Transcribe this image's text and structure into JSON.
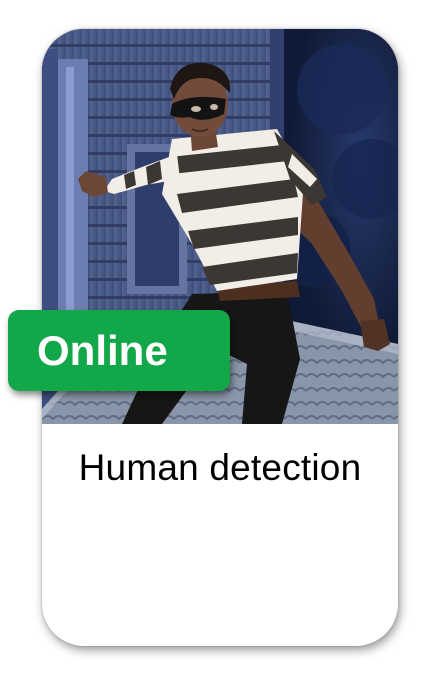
{
  "card": {
    "status_label": "Online",
    "title": "Human detection"
  },
  "colors": {
    "badge": "#12a84a",
    "badge_text": "#ffffff",
    "title_text": "#000000",
    "card_background": "#ffffff"
  },
  "icons": {
    "photo": "burglar-photo"
  }
}
